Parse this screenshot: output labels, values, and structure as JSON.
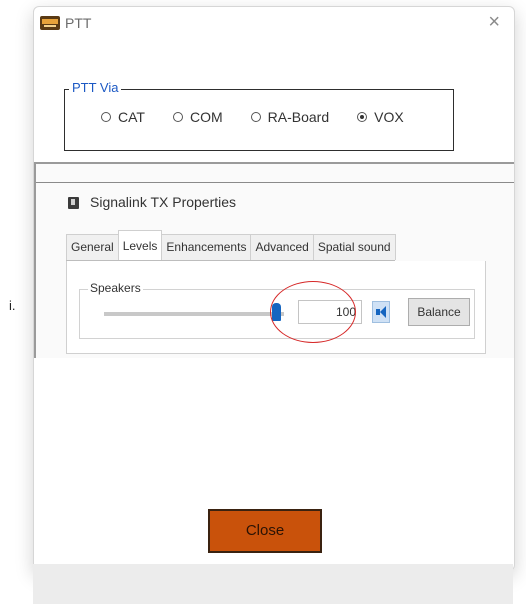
{
  "window": {
    "title": "PTT",
    "close_glyph": "×"
  },
  "ptt_via": {
    "legend": "PTT Via",
    "options": [
      {
        "label": "CAT",
        "checked": false
      },
      {
        "label": "COM",
        "checked": false
      },
      {
        "label": "RA-Board",
        "checked": false
      },
      {
        "label": "VOX",
        "checked": true
      }
    ]
  },
  "properties": {
    "title": "Signalink TX Properties",
    "tabs": [
      "General",
      "Levels",
      "Enhancements",
      "Advanced",
      "Spatial sound"
    ],
    "active_tab": "Levels",
    "speakers": {
      "label": "Speakers",
      "level": "100",
      "level_fraction": 1.0,
      "balance_label": "Balance"
    }
  },
  "side_mark": "i.",
  "close_button": "Close",
  "colors": {
    "accent_legend": "#1c59c4",
    "close_button": "#c9520b",
    "slider_thumb": "#1565c0",
    "annotation": "#d62828"
  },
  "icons": {
    "app": "ptt-app-icon",
    "speaker": "speaker-icon",
    "properties": "properties-icon"
  }
}
